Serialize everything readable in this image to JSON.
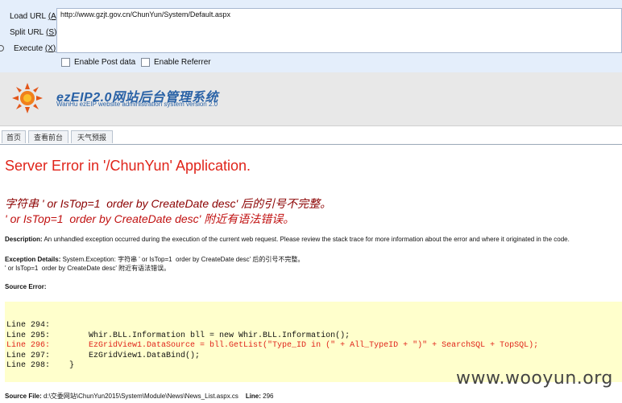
{
  "hackbar": {
    "buttons": [
      {
        "label": "Load URL",
        "key": "(A)"
      },
      {
        "label": "Split URL",
        "key": "(S)"
      },
      {
        "label": "Execute",
        "key": "(X)"
      }
    ],
    "url": "http://www.gzjt.gov.cn/ChunYun/System/Default.aspx",
    "enable_post": "Enable Post data",
    "enable_referrer": "Enable Referrer"
  },
  "cms": {
    "title": "ezEIP2.0网站后台管理系统",
    "subtitle": "WanHu ezEIP website administration system version 2.0",
    "tabs": [
      "首页",
      "查看前台",
      "天气预报"
    ]
  },
  "error": {
    "title": "Server Error in '/ChunYun' Application.",
    "message_line1": "字符串 ' or IsTop=1  order by CreateDate desc' 后的引号不完整。",
    "message_line2": "' or IsTop=1  order by CreateDate desc' 附近有语法错误。",
    "description_label": "Description:",
    "description_text": "An unhandled exception occurred during the execution of the current web request. Please review the stack trace for more information about the error and where it originated in the code.",
    "exception_label": "Exception Details:",
    "exception_text1": "System.Exception: 字符串 ' or IsTop=1  order by CreateDate desc' 后的引号不完整。",
    "exception_text2": "' or IsTop=1  order by CreateDate desc' 附近有语法错误。",
    "source_error_label": "Source Error:",
    "source_lines": [
      {
        "text": "Line 294:",
        "highlight": false
      },
      {
        "text": "Line 295:        Whir.BLL.Information bll = new Whir.BLL.Information();",
        "highlight": false
      },
      {
        "text": "Line 296:        EzGridView1.DataSource = bll.GetList(\"Type_ID in (\" + All_TypeID + \")\" + SearchSQL + TopSQL);",
        "highlight": true
      },
      {
        "text": "Line 297:        EzGridView1.DataBind();",
        "highlight": false
      },
      {
        "text": "Line 298:    }",
        "highlight": false
      }
    ],
    "source_file_label": "Source File:",
    "source_file": "d:\\交委网站\\ChunYun2015\\System\\Module\\News\\News_List.aspx.cs",
    "line_label": "Line:",
    "line_number": "296"
  },
  "watermark": "www.wooyun.org"
}
